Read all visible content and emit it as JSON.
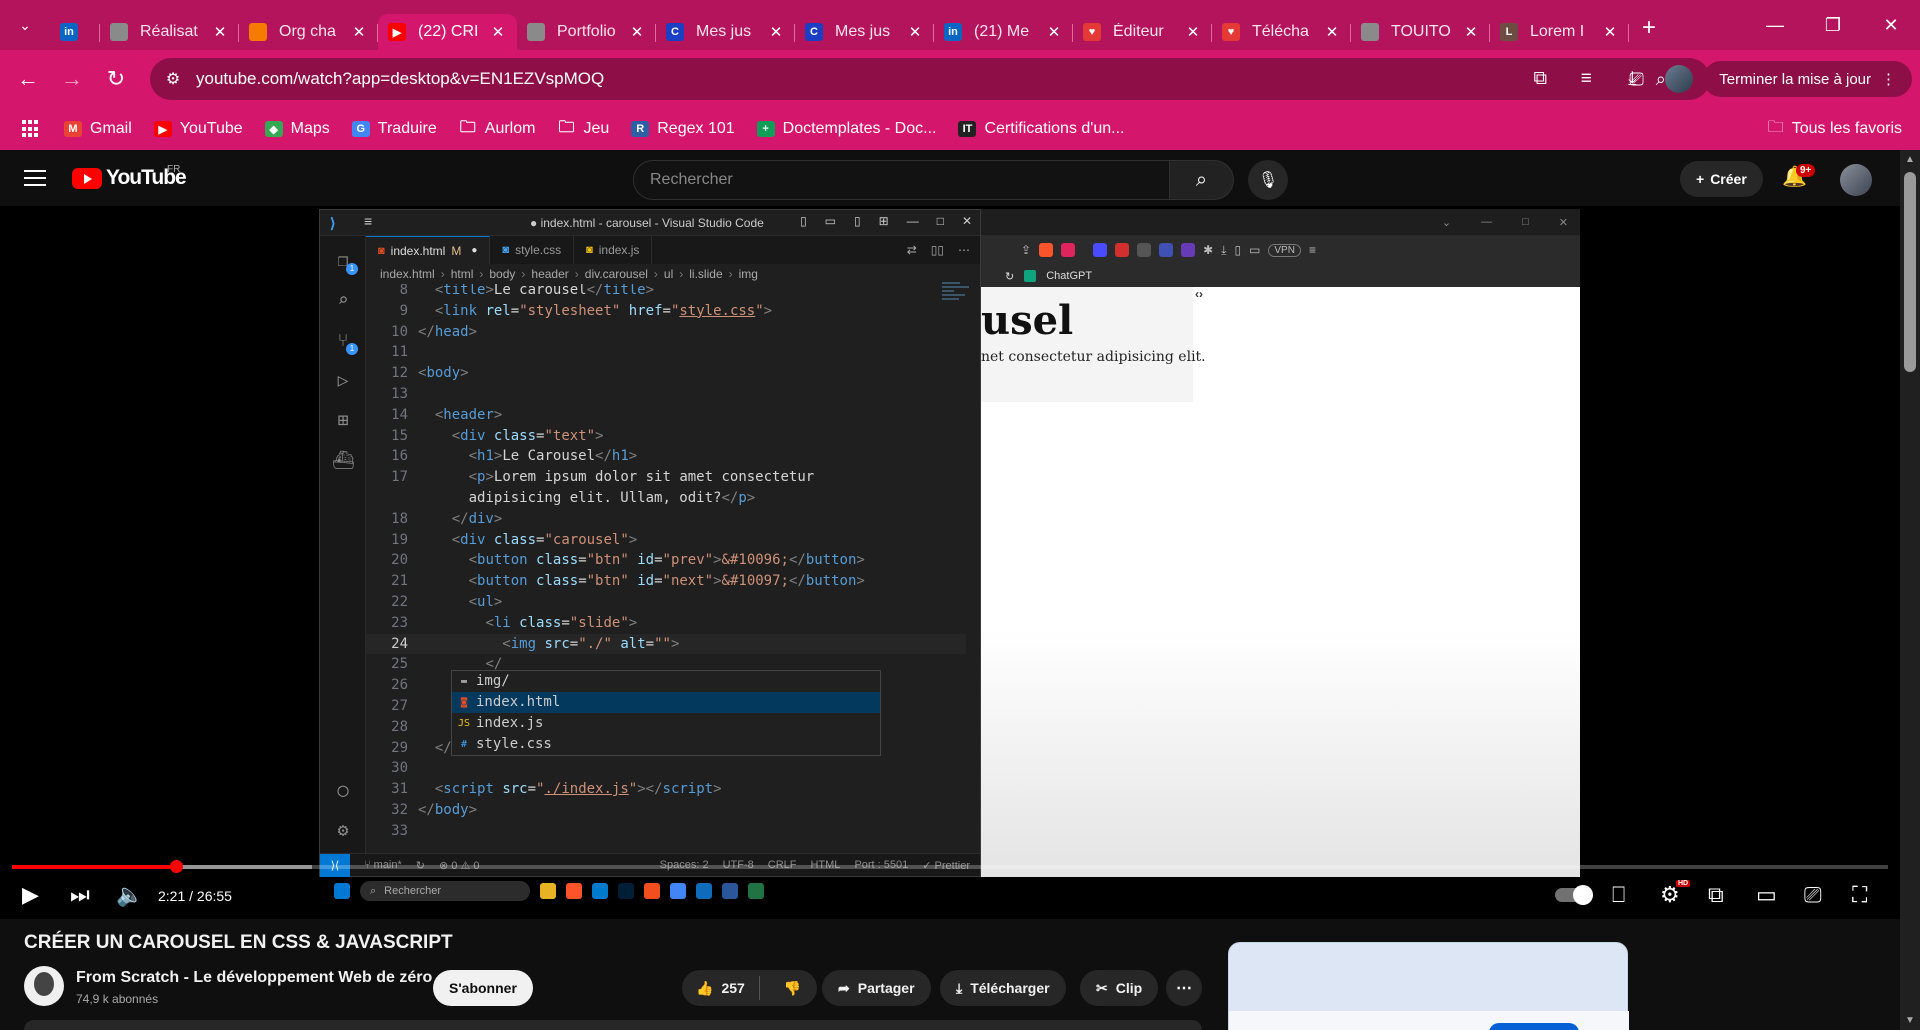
{
  "browser": {
    "tabs": [
      {
        "title": "",
        "icon": "linkedin-icon",
        "color": "#0a66c2",
        "glyph": "in"
      },
      {
        "title": "Réalisat",
        "icon": "globe-icon",
        "color": "#8a8a8a",
        "glyph": ""
      },
      {
        "title": "Org cha",
        "icon": "orgchart-icon",
        "color": "#f57c00",
        "glyph": ""
      },
      {
        "title": "(22) CRI",
        "icon": "youtube-icon",
        "color": "#ff0000",
        "glyph": "▶",
        "active": true
      },
      {
        "title": "Portfolio",
        "icon": "globe-icon",
        "color": "#8a8a8a",
        "glyph": ""
      },
      {
        "title": "Mes jus",
        "icon": "c-icon",
        "color": "#1a3fc4",
        "glyph": "C"
      },
      {
        "title": "Mes jus",
        "icon": "c-icon",
        "color": "#1a3fc4",
        "glyph": "C"
      },
      {
        "title": "(21) Me",
        "icon": "linkedin-icon",
        "color": "#0a66c2",
        "glyph": "in"
      },
      {
        "title": "Éditeur",
        "icon": "heart-icon",
        "color": "#e53935",
        "glyph": "♥"
      },
      {
        "title": "Télécha",
        "icon": "heart-icon",
        "color": "#e53935",
        "glyph": "♥"
      },
      {
        "title": "TOUITO",
        "icon": "globe-icon",
        "color": "#8a8a8a",
        "glyph": ""
      },
      {
        "title": "Lorem I",
        "icon": "doc-icon",
        "color": "#6d4c41",
        "glyph": "L"
      }
    ],
    "url": "youtube.com/watch?app=desktop&v=EN1EZVspMOQ",
    "update_label": "Terminer la mise à jour",
    "bookmarks": [
      {
        "label": "Gmail",
        "color": "#ea4335",
        "glyph": "M"
      },
      {
        "label": "YouTube",
        "color": "#ff0000",
        "glyph": "▶"
      },
      {
        "label": "Maps",
        "color": "#34a853",
        "glyph": "◆"
      },
      {
        "label": "Traduire",
        "color": "#4285f4",
        "glyph": "G"
      },
      {
        "label": "Aurlom",
        "color": "",
        "glyph": "folder"
      },
      {
        "label": "Jeu",
        "color": "",
        "glyph": "folder"
      },
      {
        "label": "Regex 101",
        "color": "#2b5fa6",
        "glyph": "R"
      },
      {
        "label": "Doctemplates - Doc...",
        "color": "#0f9d58",
        "glyph": "+"
      },
      {
        "label": "Certifications d'un...",
        "color": "#222222",
        "glyph": "IT"
      }
    ],
    "all_bookmarks": "Tous les favoris"
  },
  "youtube": {
    "logo": "YouTube",
    "country": "FR",
    "search_placeholder": "Rechercher",
    "create_label": "Créer",
    "notif_count": "9+",
    "video": {
      "time": "2:21 / 26:55",
      "progress": 0.0874,
      "loaded": 0.16,
      "title": "CRÉER UN CAROUSEL EN CSS & JAVASCRIPT",
      "channel": "From Scratch - Le développement Web de zéro",
      "subscribers": "74,9 k abonnés",
      "subscribe_label": "S'abonner",
      "likes": "257",
      "share_label": "Partager",
      "download_label": "Télécharger",
      "clip_label": "Clip"
    }
  },
  "vscode": {
    "window_title": "● index.html - carousel - Visual Studio Code",
    "tabs": [
      {
        "label": "index.html",
        "flag": "M",
        "active": true,
        "icon": "html-file-icon",
        "color": "#e44d26"
      },
      {
        "label": "style.css",
        "flag": "",
        "active": false,
        "icon": "css-file-icon",
        "color": "#42a5f5"
      },
      {
        "label": "index.js",
        "flag": "",
        "active": false,
        "icon": "js-file-icon",
        "color": "#f1c40f"
      }
    ],
    "breadcrumb": [
      "index.html",
      "html",
      "body",
      "header",
      "div.carousel",
      "ul",
      "li.slide",
      "img"
    ],
    "lines": [
      {
        "n": "8",
        "i": 1,
        "html": "<span class='punct'>&lt;</span><span class='tag'>title</span><span class='punct'>&gt;</span><span class='txt'>Le carousel</span><span class='punct'>&lt;/</span><span class='tag'>title</span><span class='punct'>&gt;</span>"
      },
      {
        "n": "9",
        "i": 1,
        "html": "<span class='punct'>&lt;</span><span class='tag'>link</span> <span class='attr'>rel</span><span class='txt'>=</span><span class='str'>\"stylesheet\"</span> <span class='attr'>href</span><span class='txt'>=</span><span class='str'>\"</span><span class='ulnk'>style.css</span><span class='str'>\"</span><span class='punct'>&gt;</span>"
      },
      {
        "n": "10",
        "i": 0,
        "html": "<span class='punct'>&lt;/</span><span class='tag'>head</span><span class='punct'>&gt;</span>"
      },
      {
        "n": "11",
        "i": 0,
        "html": ""
      },
      {
        "n": "12",
        "i": 0,
        "html": "<span class='punct'>&lt;</span><span class='tag'>body</span><span class='punct'>&gt;</span>"
      },
      {
        "n": "13",
        "i": 0,
        "html": ""
      },
      {
        "n": "14",
        "i": 1,
        "html": "<span class='punct'>&lt;</span><span class='tag'>header</span><span class='punct'>&gt;</span>"
      },
      {
        "n": "15",
        "i": 2,
        "html": "<span class='punct'>&lt;</span><span class='tag'>div</span> <span class='attr'>class</span><span class='txt'>=</span><span class='str'>\"text\"</span><span class='punct'>&gt;</span>"
      },
      {
        "n": "16",
        "i": 3,
        "html": "<span class='punct'>&lt;</span><span class='tag'>h1</span><span class='punct'>&gt;</span><span class='txt'>Le Carousel</span><span class='punct'>&lt;/</span><span class='tag'>h1</span><span class='punct'>&gt;</span>"
      },
      {
        "n": "17",
        "i": 3,
        "html": "<span class='punct'>&lt;</span><span class='tag'>p</span><span class='punct'>&gt;</span><span class='txt'>Lorem ipsum dolor sit amet consectetur</span>"
      },
      {
        "n": "",
        "i": 3,
        "html": "<span class='txt'>adipisicing elit. Ullam, odit?</span><span class='punct'>&lt;/</span><span class='tag'>p</span><span class='punct'>&gt;</span>"
      },
      {
        "n": "18",
        "i": 2,
        "html": "<span class='punct'>&lt;/</span><span class='tag'>div</span><span class='punct'>&gt;</span>"
      },
      {
        "n": "19",
        "i": 2,
        "html": "<span class='punct'>&lt;</span><span class='tag'>div</span> <span class='attr'>class</span><span class='txt'>=</span><span class='str'>\"carousel\"</span><span class='punct'>&gt;</span>"
      },
      {
        "n": "20",
        "i": 3,
        "html": "<span class='punct'>&lt;</span><span class='tag'>button</span> <span class='attr'>class</span><span class='txt'>=</span><span class='str'>\"btn\"</span> <span class='attr'>id</span><span class='txt'>=</span><span class='str'>\"prev\"</span><span class='punct'>&gt;</span><span class='ent'>&amp;#10096;</span><span class='punct'>&lt;/</span><span class='tag'>button</span><span class='punct'>&gt;</span>"
      },
      {
        "n": "21",
        "i": 3,
        "html": "<span class='punct'>&lt;</span><span class='tag'>button</span> <span class='attr'>class</span><span class='txt'>=</span><span class='str'>\"btn\"</span> <span class='attr'>id</span><span class='txt'>=</span><span class='str'>\"next\"</span><span class='punct'>&gt;</span><span class='ent'>&amp;#10097;</span><span class='punct'>&lt;/</span><span class='tag'>button</span><span class='punct'>&gt;</span>"
      },
      {
        "n": "22",
        "i": 3,
        "html": "<span class='punct'>&lt;</span><span class='tag'>ul</span><span class='punct'>&gt;</span>"
      },
      {
        "n": "23",
        "i": 4,
        "html": "<span class='punct'>&lt;</span><span class='tag'>li</span> <span class='attr'>class</span><span class='txt'>=</span><span class='str'>\"slide\"</span><span class='punct'>&gt;</span>"
      },
      {
        "n": "24",
        "i": 5,
        "cur": true,
        "html": "<span class='punct'>&lt;</span><span class='tag'>img</span> <span class='attr'>src</span><span class='txt'>=</span><span class='str'>\"./\"</span> <span class='attr'>alt</span><span class='txt'>=</span><span class='str'>\"\"</span><span class='punct'>&gt;</span>"
      },
      {
        "n": "25",
        "i": 4,
        "html": "<span class='punct'>&lt;/</span>"
      },
      {
        "n": "26",
        "i": 3,
        "html": "<span class='punct'>&lt;/</span><span class='tag'>ul</span>"
      },
      {
        "n": "27",
        "i": 2,
        "html": "<span class='punct'>&lt;/</span><span class='tag'>div</span><span class='punct'>&gt;</span>"
      },
      {
        "n": "28",
        "i": 0,
        "html": ""
      },
      {
        "n": "29",
        "i": 1,
        "html": "<span class='punct'>&lt;/</span><span class='tag'>header</span><span class='punct'>&gt;</span>"
      },
      {
        "n": "30",
        "i": 0,
        "html": ""
      },
      {
        "n": "31",
        "i": 1,
        "html": "<span class='punct'>&lt;</span><span class='tag'>script</span> <span class='attr'>src</span><span class='txt'>=</span><span class='str'>\"</span><span class='ulnk'>./index.js</span><span class='str'>\"</span><span class='punct'>&gt;&lt;/</span><span class='tag'>script</span><span class='punct'>&gt;</span>"
      },
      {
        "n": "32",
        "i": 0,
        "html": "<span class='punct'>&lt;/</span><span class='tag'>body</span><span class='punct'>&gt;</span>"
      },
      {
        "n": "33",
        "i": 0,
        "html": ""
      }
    ],
    "suggestions": [
      {
        "label": "img/",
        "icon": "folder-icon",
        "color": "#9e9e9e",
        "glyph": "▬"
      },
      {
        "label": "index.html",
        "icon": "html-file-icon",
        "color": "#e44d26",
        "glyph": "◙",
        "selected": true
      },
      {
        "label": "index.js",
        "icon": "js-file-icon",
        "color": "#f1c40f",
        "glyph": "JS"
      },
      {
        "label": "style.css",
        "icon": "css-file-icon",
        "color": "#42a5f5",
        "glyph": "#"
      }
    ],
    "status": {
      "branch": "main*",
      "problems": "⊗ 0 ⚠ 0",
      "right": [
        "Spaces: 2",
        "UTF-8",
        "CRLF",
        "HTML",
        "Port : 5501",
        "✓ Prettier"
      ]
    },
    "taskbar_search": "Rechercher"
  },
  "preview": {
    "heading": "usel",
    "paragraph": "net consectetur adipisicing elit.",
    "bookmark": "ChatGPT",
    "vpn": "VPN"
  }
}
